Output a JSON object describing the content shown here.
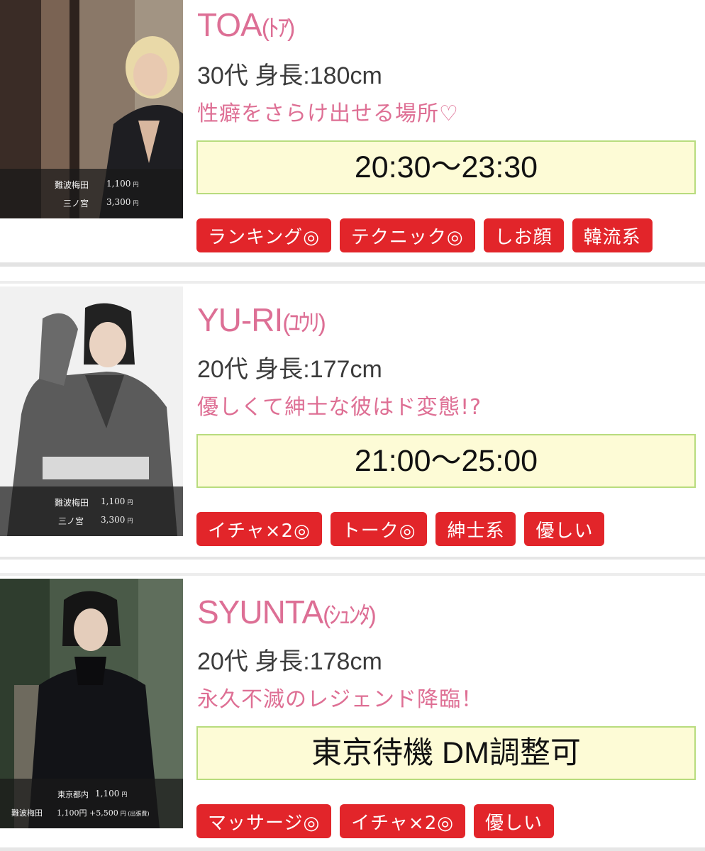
{
  "profiles": [
    {
      "name": "TOA",
      "kana": "(ﾄｱ)",
      "age_height": "30代 身長:180cm",
      "catchphrase": "性癖をさらけ出せる場所♡",
      "schedule": "20:30〜23:30",
      "prices": [
        {
          "area": "難波梅田",
          "price": "1,100",
          "unit": "円"
        },
        {
          "area": "三ノ宮",
          "price": "3,300",
          "unit": "円"
        }
      ],
      "tags": [
        "ランキング◎",
        "テクニック◎",
        "しお顔",
        "韓流系"
      ]
    },
    {
      "name": "YU-RI",
      "kana": "(ﾕｳﾘ)",
      "age_height": "20代 身長:177cm",
      "catchphrase": "優しくて紳士な彼はド変態!?",
      "schedule": "21:00〜25:00",
      "prices": [
        {
          "area": "難波梅田",
          "price": "1,100",
          "unit": "円"
        },
        {
          "area": "三ノ宮",
          "price": "3,300",
          "unit": "円"
        }
      ],
      "tags": [
        "イチャ×2◎",
        "トーク◎",
        "紳士系",
        "優しい"
      ]
    },
    {
      "name": "SYUNTA",
      "kana": "(ｼｭﾝﾀ)",
      "age_height": "20代 身長:178cm",
      "catchphrase": "永久不滅のレジェンド降臨！",
      "schedule": "東京待機 DM調整可",
      "prices": [
        {
          "area": "東京都内",
          "price": "1,100",
          "unit": "円"
        },
        {
          "area": "難波梅田",
          "price": "1,100円 +5,500",
          "unit": "円 (出張費)"
        }
      ],
      "tags": [
        "マッサージ◎",
        "イチャ×2◎",
        "優しい"
      ]
    }
  ],
  "colors": {
    "name": "#dd6f95",
    "catchphrase": "#de6f94",
    "tag_bg": "#e2252a",
    "schedule_bg": "#fdfbd6",
    "schedule_border": "#b8dc7e"
  },
  "icons": [
    "portrait-photo"
  ]
}
